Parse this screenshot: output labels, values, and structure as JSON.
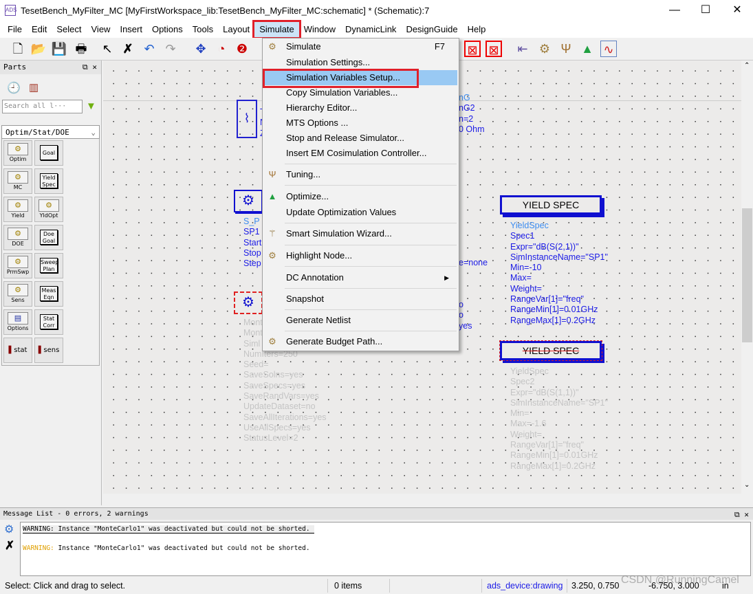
{
  "window": {
    "title": "TesetBench_MyFilter_MC [MyFirstWorkspace_lib:TesetBench_MyFilter_MC:schematic] * (Schematic):7",
    "minimize": "—",
    "maximize": "☐",
    "close": "✕"
  },
  "menubar": [
    "File",
    "Edit",
    "Select",
    "View",
    "Insert",
    "Options",
    "Tools",
    "Layout",
    "Simulate",
    "Window",
    "DynamicLink",
    "DesignGuide",
    "Help"
  ],
  "active_menu": "Simulate",
  "simulate_menu": [
    {
      "label": "Simulate",
      "shortcut": "F7",
      "icon": "gear-icon"
    },
    {
      "label": "Simulation Settings..."
    },
    {
      "label": "Simulation Variables Setup...",
      "highlighted": true
    },
    {
      "label": "Copy Simulation Variables..."
    },
    {
      "label": "Hierarchy Editor..."
    },
    {
      "label": "MTS Options ..."
    },
    {
      "label": "Stop and Release Simulator..."
    },
    {
      "label": "Insert EM Cosimulation Controller..."
    },
    {
      "label": "Tuning...",
      "icon": "tuning-fork-icon"
    },
    {
      "label": "Optimize...",
      "icon": "optimize-arrow-icon"
    },
    {
      "label": "Update Optimization Values"
    },
    {
      "label": "Smart Simulation Wizard...",
      "icon": "wand-icon"
    },
    {
      "label": "Highlight Node...",
      "icon": "gear-icon"
    },
    {
      "label": "DC Annotation",
      "submenu": true
    },
    {
      "label": "Snapshot"
    },
    {
      "label": "Generate Netlist"
    },
    {
      "label": "Generate Budget Path...",
      "icon": "gear-icon"
    }
  ],
  "parts": {
    "title": "Parts",
    "search_placeholder": "Search all l···",
    "library": "Optim/Stat/DOE",
    "items": [
      "Optim",
      "Goal",
      "MC",
      "Yield Spec",
      "Yield",
      "YldOpt",
      "DOE",
      "Doe Goal",
      "PrmSwp",
      "Sweep Plan",
      "Sens",
      "Meas Eqn",
      "Options",
      "Stat Corr",
      "stat",
      "sens"
    ]
  },
  "canvas": {
    "term": [
      "T",
      "N",
      "Z"
    ],
    "term_right": [
      "nG",
      "nG2",
      "n=2",
      "0 Ohm"
    ],
    "sparam": [
      "S_P",
      "SP1",
      "Start",
      "Stop",
      "Step"
    ],
    "sparam_right": "e=none",
    "mc_right": [
      "o",
      "o",
      "yes"
    ],
    "montecarlo": [
      "Mont",
      "Mont",
      "Siml",
      "NumIters=250",
      "Seed=",
      "SaveSolns=yes",
      "SaveSpecs=yes",
      "SaveRandVars=yes",
      "UpdateDataset=no",
      "SaveAllIterations=yes",
      "UseAllSpecs=yes",
      "StatusLevel=2"
    ],
    "yield_spec_1": {
      "label": "YIELD SPEC",
      "lines": [
        "YieldSpec",
        "Spec1",
        "Expr=\"dB(S(2,1))\"",
        "SimInstanceName=\"SP1\"",
        "Min=-10",
        "Max=",
        "Weight=",
        "RangeVar[1]=\"freq\"",
        "RangeMin[1]=0.01GHz",
        "RangeMax[1]=0.2GHz"
      ]
    },
    "yield_spec_2": {
      "label": "YIELD SPEC",
      "lines": [
        "YieldSpec",
        "Spec2",
        "Expr=\"dB(S(1,1))\"",
        "SimInstanceName=\"SP1\"",
        "Min=",
        "Max=-1.6",
        "Weight=",
        "RangeVar[1]=\"freq\"",
        "RangeMin[1]=0.01GHz",
        "RangeMax[1]=0.2GHz"
      ]
    }
  },
  "messages": {
    "title": "Message List - 0 errors, 2 warnings",
    "items": [
      {
        "level": "WARNING:",
        "text": " Instance \"MonteCarlo1\" was deactivated but could not be shorted."
      },
      {
        "level": "WARNING:",
        "text": " Instance \"MonteCarlo1\" was deactivated but could not be shorted."
      }
    ]
  },
  "status": {
    "hint": "Select: Click and drag to select.",
    "items": "0 items",
    "layer": "ads_device:drawing",
    "coord1": "3.250, 0.750",
    "coord2": "-6.750, 3.000",
    "unit": "in",
    "watermark": "CSDN @RunningCamel"
  },
  "colors": {
    "highlight_box": "#e0202a",
    "menu_highlight": "#99c9f3",
    "component_blue": "#1010d0",
    "warning": "#e0a000"
  }
}
